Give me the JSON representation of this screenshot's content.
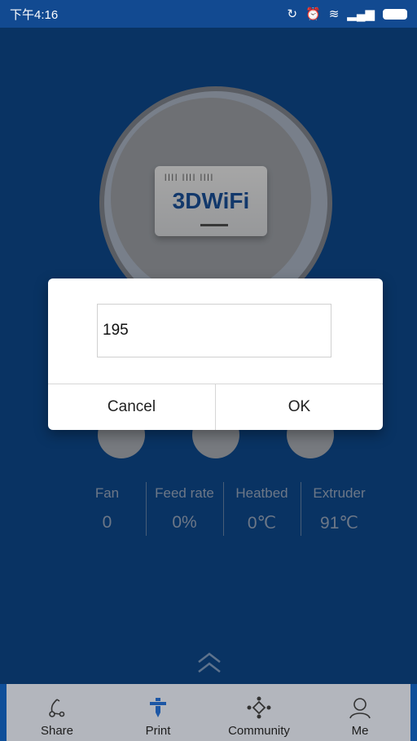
{
  "status_bar": {
    "time": "下午4:16"
  },
  "device": {
    "product_name": "3DWiFi",
    "led_text": "|||| |||| ||||"
  },
  "stats": [
    {
      "label": "Fan",
      "value": "0"
    },
    {
      "label": "Feed rate",
      "value": "0%"
    },
    {
      "label": "Heatbed",
      "value": "0℃"
    },
    {
      "label": "Extruder",
      "value": "91℃"
    }
  ],
  "dialog": {
    "input_value": "195",
    "cancel_label": "Cancel",
    "ok_label": "OK"
  },
  "bottom_nav": {
    "items": [
      {
        "label": "Share",
        "icon": "share-icon"
      },
      {
        "label": "Print",
        "icon": "print-icon"
      },
      {
        "label": "Community",
        "icon": "community-icon"
      },
      {
        "label": "Me",
        "icon": "me-icon"
      }
    ]
  },
  "colors": {
    "background": "#0f4f99",
    "nav_bg": "#b3b6bd",
    "accent": "#1d57a5"
  }
}
